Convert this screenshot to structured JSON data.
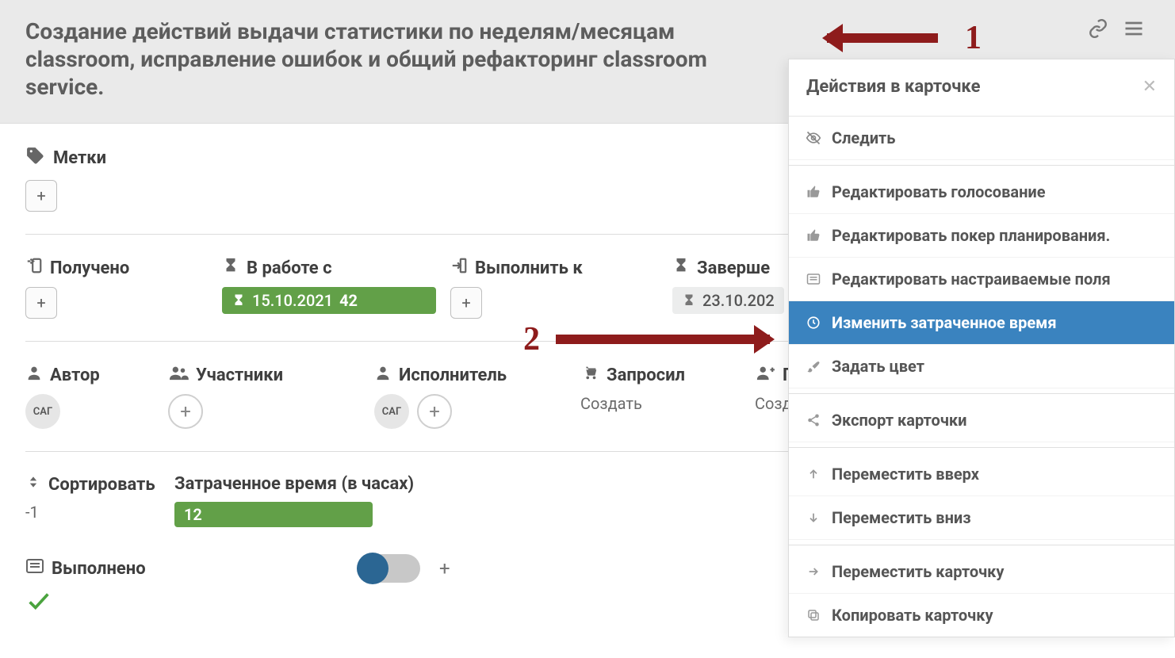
{
  "header": {
    "title": "Создание действий выдачи статистики по неделям/месяцам classroom, исправление ошибок и общий рефакторинг classroom service."
  },
  "labels_section": {
    "title": "Метки"
  },
  "status": {
    "received_label": "Получено",
    "in_work_label": "В работе с",
    "in_work_date": "15.10.2021",
    "in_work_days": "42",
    "due_label": "Выполнить к",
    "done_label": "Заверше",
    "done_date": "23.10.202"
  },
  "people": {
    "author_label": "Автор",
    "author_initials": "САГ",
    "members_label": "Участники",
    "executor_label": "Исполнитель",
    "executor_initials": "САГ",
    "requested_label": "Запросил",
    "requested_action": "Создать",
    "helper_label": "По",
    "helper_action": "Созда"
  },
  "sort": {
    "sort_label": "Сортировать",
    "sort_value": "-1",
    "time_label": "Затраченное время (в часах)",
    "time_value": "12"
  },
  "done_toggle": {
    "label": "Выполнено"
  },
  "menu": {
    "title": "Действия в карточке",
    "items": {
      "watch": "Следить",
      "edit_vote": "Редактировать голосование",
      "edit_poker": "Редактировать покер планирования.",
      "edit_fields": "Редактировать настраиваемые поля",
      "edit_time": "Изменить затраченное время",
      "set_color": "Задать цвет",
      "export": "Экспорт карточки",
      "move_up": "Переместить вверх",
      "move_down": "Переместить вниз",
      "move_card": "Переместить карточку",
      "copy_card": "Копировать карточку"
    }
  },
  "annot": {
    "one": "1",
    "two": "2"
  }
}
